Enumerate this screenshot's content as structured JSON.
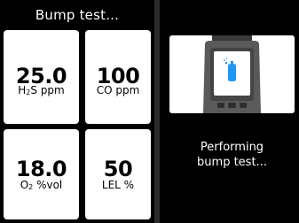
{
  "header": {
    "title": "Bump test..."
  },
  "sensors": [
    {
      "value": "25.0",
      "gas_main": "H",
      "gas_sub": "2",
      "gas_rest": "S",
      "unit": " ppm"
    },
    {
      "value": "100",
      "gas_main": "CO",
      "gas_sub": "",
      "gas_rest": "",
      "unit": " ppm"
    },
    {
      "value": "18.0",
      "gas_main": "O",
      "gas_sub": "2",
      "gas_rest": "",
      "unit": " %vol"
    },
    {
      "value": "50",
      "gas_main": "LEL",
      "gas_sub": "",
      "gas_rest": "",
      "unit": " %"
    }
  ],
  "status": {
    "line1": "Performing",
    "line2": "bump test..."
  },
  "icons": {
    "device": "gas-detector-icon",
    "cylinder": "gas-cylinder-icon"
  },
  "colors": {
    "background": "#000000",
    "tile": "#ffffff",
    "divider": "#2b2b2b",
    "device_body": "#5a5a5a",
    "device_screen": "#ffffff",
    "cylinder": "#2196f3"
  }
}
